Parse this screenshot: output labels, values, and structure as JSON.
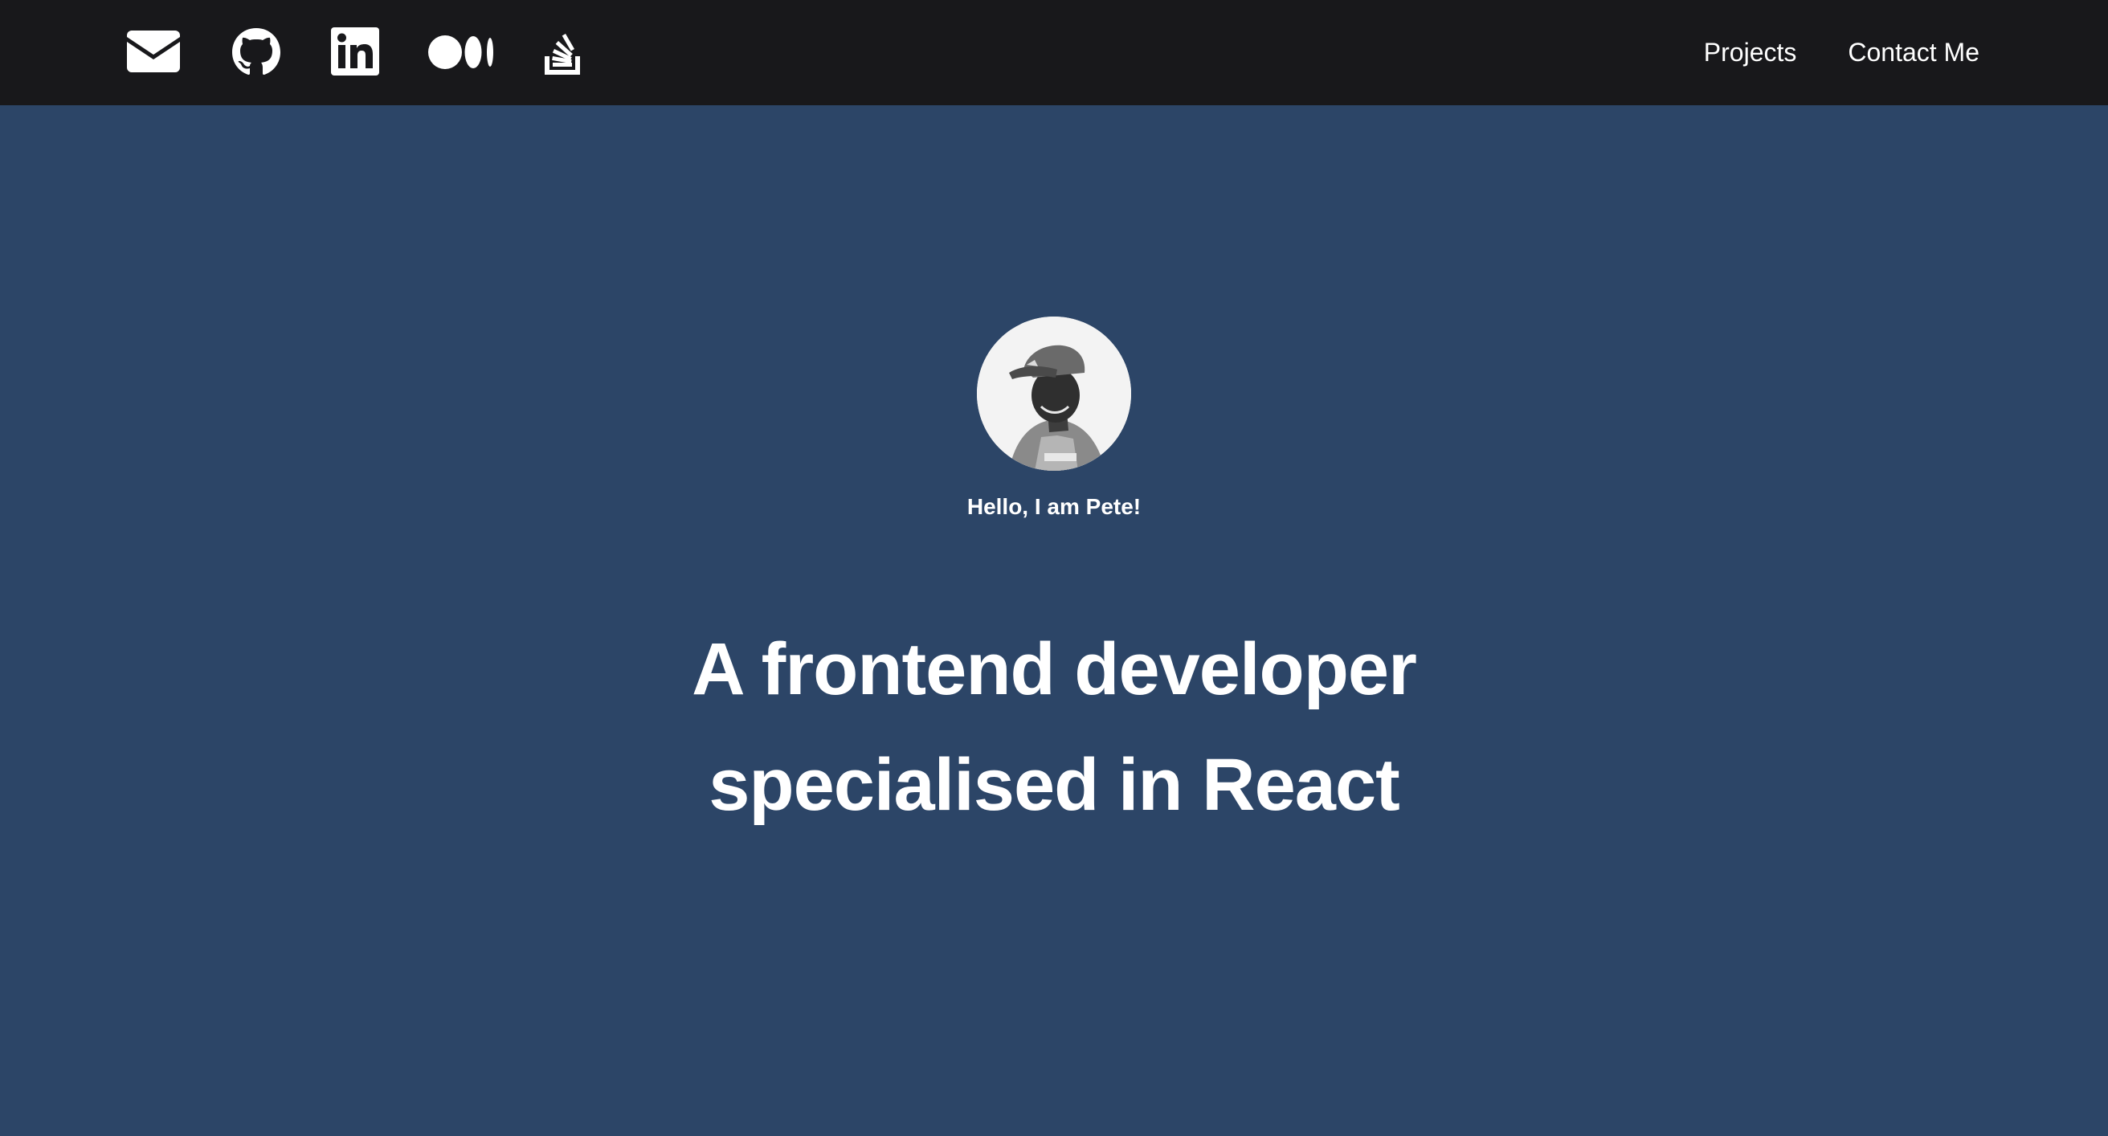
{
  "nav": {
    "social_icons": [
      "envelope-icon",
      "github-icon",
      "linkedin-icon",
      "medium-icon",
      "stackoverflow-icon"
    ],
    "links": [
      {
        "label": "Projects"
      },
      {
        "label": "Contact Me"
      }
    ]
  },
  "hero": {
    "greeting": "Hello, I am Pete!",
    "headline_line1": "A frontend developer",
    "headline_line2": "specialised in React"
  },
  "colors": {
    "header_bg": "#18181b",
    "hero_bg": "#2c4567",
    "text": "#ffffff"
  }
}
